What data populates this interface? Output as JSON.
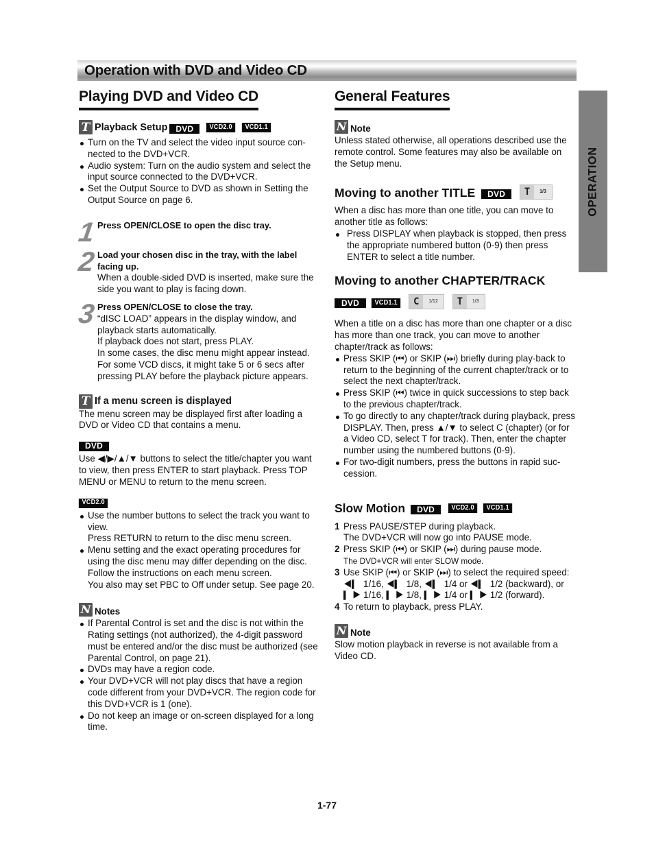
{
  "banner": {
    "title": "Operation with DVD and Video CD"
  },
  "side_tab": {
    "label": "OPERATION"
  },
  "left": {
    "title": "Playing DVD and Video CD",
    "playback_setup": {
      "icon": "tip-icon",
      "icon_glyph": "T",
      "heading": "Playback Setup",
      "badges": [
        "DVD",
        "VCD2.0",
        "VCD1.1"
      ],
      "bullets": [
        "Turn on the TV and select the video input source con-nected to the DVD+VCR.",
        "Audio system: Turn on the audio system and select the input source connected to the DVD+VCR.",
        "Set the Output Source to DVD as shown in Setting the Output Source on page 6."
      ]
    },
    "steps": [
      {
        "num": "1",
        "bold": "Press OPEN/CLOSE to open the disc tray.",
        "lines": []
      },
      {
        "num": "2",
        "bold": "Load your chosen disc in the tray, with the label facing up.",
        "lines": [
          "When a double-sided DVD is inserted, make sure the side you want to play is facing down."
        ]
      },
      {
        "num": "3",
        "bold": "Press OPEN/CLOSE to close the tray.",
        "lines": [
          "“dISC LOAD” appears in the display window, and playback starts automatically.",
          "If playback does not start, press PLAY.",
          "In some cases, the disc menu might appear instead.",
          "For some VCD discs, it might take 5 or 6 secs after pressing PLAY before the playback picture appears."
        ]
      }
    ],
    "menu_screen": {
      "icon": "tip-icon",
      "icon_glyph": "T",
      "heading": "If a menu screen is displayed",
      "intro": "The menu screen may be displayed first after loading a DVD or Video CD that contains a menu.",
      "dvd_badge": "DVD",
      "dvd_text": "Use ◀/▶/▲/▼ buttons to select the title/chapter you want to view, then press ENTER to start playback. Press TOP MENU or MENU to return to the menu screen.",
      "vcd_badge": "VCD2.0",
      "vcd_bullets": [
        {
          "text": "Use the number buttons to select the track you want to view.",
          "extra": "Press RETURN to return to the disc menu screen."
        },
        {
          "text": "Menu setting and the exact operating procedures for using the disc menu may differ depending on the disc. Follow the instructions on each menu screen.",
          "extra": "You also may set PBC to Off under setup. See page 20."
        }
      ]
    },
    "notes": {
      "icon": "note-icon",
      "icon_glyph": "N",
      "heading": "Notes",
      "bullets": [
        "If Parental Control is set and the disc is not within the Rating settings (not authorized), the 4-digit password must be entered and/or the disc must be authorized (see Parental Control, on page 21).",
        "DVDs may have a region code.",
        "Your DVD+VCR will not play discs that have a region code different from your DVD+VCR. The region code for this DVD+VCR is 1 (one).",
        "Do not keep an image or on-screen displayed for a long time."
      ]
    }
  },
  "right": {
    "title": "General Features",
    "note1": {
      "icon_glyph": "N",
      "heading": "Note",
      "text": "Unless stated otherwise, all operations described use the remote control. Some features may also be available on the Setup menu."
    },
    "title_section": {
      "heading": "Moving to another TITLE",
      "badge": "DVD",
      "display": {
        "glyph": "T",
        "value": "1/3"
      },
      "intro": "When a disc has more than one title, you can move to another title as follows:",
      "bullets": [
        "Press DISPLAY when playback is stopped, then press the appropriate numbered button (0-9) then press ENTER to select a title number."
      ]
    },
    "chapter_section": {
      "heading": "Moving to another CHAPTER/TRACK",
      "badges": [
        "DVD",
        "VCD1.1"
      ],
      "displays": [
        {
          "glyph": "C",
          "value": "1/12"
        },
        {
          "glyph": "T",
          "value": "1/3"
        }
      ],
      "intro": "When a title on a disc has more than one chapter or a disc has more than one track, you can move to another chapter/track as follows:",
      "bullets": [
        "Press SKIP (⏮) or SKIP (⏭) briefly during play-back to return to the beginning of the current chapter/track or to select the next chapter/track.",
        "Press SKIP (⏮) twice in quick successions to step back to the previous chapter/track.",
        "To go directly to any chapter/track during playback, press DISPLAY. Then, press ▲/▼ to select C (chapter) (or for a Video CD, select T for track). Then, enter the chapter number using the numbered buttons (0-9).",
        "For two-digit numbers, press the buttons in rapid suc-cession."
      ]
    },
    "slow_motion": {
      "heading": "Slow Motion",
      "badges": [
        "DVD",
        "VCD2.0",
        "VCD1.1"
      ],
      "steps": [
        {
          "n": "1",
          "text": "Press PAUSE/STEP during playback.",
          "extra": "The DVD+VCR will now go into PAUSE mode.",
          "extra_small": false
        },
        {
          "n": "2",
          "text": "Press SKIP (⏮) or SKIP (⏭) during pause mode.",
          "extra": "The DVD+VCR will enter SLOW mode.",
          "extra_small": true
        },
        {
          "n": "3",
          "text": "Use SKIP (⏮) or SKIP (⏭) to select the required speed: ◀▎ 1/16, ◀▎ 1/8, ◀▎ 1/4 or ◀▎ 1/2 (backward), or ▎▶ 1/16, ▎▶ 1/8, ▎▶ 1/4 or ▎▶ 1/2 (forward).",
          "extra": "",
          "extra_small": false
        },
        {
          "n": "4",
          "text": "To return to playback, press PLAY.",
          "extra": "",
          "extra_small": false
        }
      ]
    },
    "note2": {
      "icon_glyph": "N",
      "heading": "Note",
      "text": "Slow motion playback in reverse is not available from a Video CD."
    }
  },
  "footer": {
    "page_number": "1-77"
  }
}
